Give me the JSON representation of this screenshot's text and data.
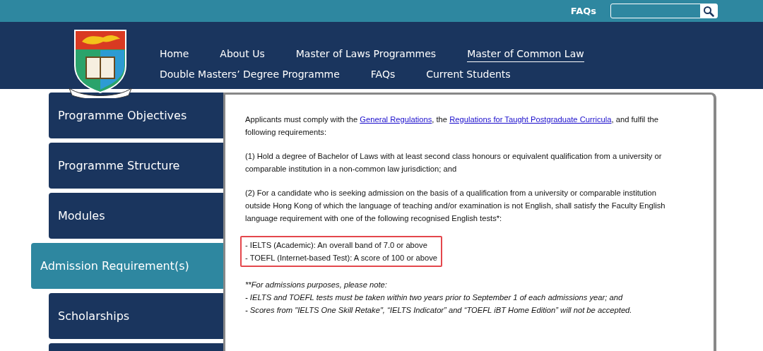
{
  "top_bar": {
    "link": "FAQs"
  },
  "nav": [
    {
      "label": "Home",
      "selected": false
    },
    {
      "label": "About Us",
      "selected": false
    },
    {
      "label": "Master of Laws Programmes",
      "selected": false
    },
    {
      "label": "Master of Common Law",
      "selected": true
    },
    {
      "label": "Double Masters’ Degree Programme",
      "selected": false
    },
    {
      "label": "FAQs",
      "selected": false
    },
    {
      "label": "Current Students",
      "selected": false
    }
  ],
  "sidebar": {
    "items": [
      {
        "label": "Programme Objectives",
        "selected": false
      },
      {
        "label": "Programme Structure",
        "selected": false
      },
      {
        "label": "Modules",
        "selected": false
      },
      {
        "label": "Admission Requirement(s)",
        "selected": true
      },
      {
        "label": "Scholarships",
        "selected": false
      }
    ]
  },
  "content": {
    "blocks": [
      {
        "kind": "paragraph",
        "parts": [
          {
            "link": false,
            "text": "Applicants must comply with the "
          },
          {
            "link": true,
            "text": "General Regulations"
          },
          {
            "link": false,
            "text": ", the "
          },
          {
            "link": true,
            "text": "Regulations for Taught Postgraduate Curricula"
          },
          {
            "link": false,
            "text": ", and fulfil the following requirements:"
          }
        ]
      },
      {
        "kind": "paragraph",
        "text": "(1) Hold a degree of Bachelor of Laws with at least second class honours or equivalent qualification from a university or comparable institution in a non-common law jurisdiction; and"
      },
      {
        "kind": "paragraph",
        "text": "(2) For a candidate who is seeking admission on the basis of a qualification from a university or comparable institution outside Hong Kong of which the language of teaching and/or examination is not English, shall satisfy the Faculty English language requirement with one of the following recognised English tests*:"
      },
      {
        "kind": "list",
        "highlighted": true,
        "lines": [
          "- IELTS (Academic): An overall band of 7.0 or above",
          "- TOEFL (Internet-based Test): A score of 100 or above"
        ]
      },
      {
        "kind": "note",
        "lines": [
          "**For admissions purposes, please note:",
          "- IELTS and TOEFL tests must be taken within two years prior to September 1 of each admissions year; and",
          "- Scores from \"IELTS One Skill Retake\", “IELTS Indicator” and “TOEFL iBT Home Edition” will not be accepted."
        ]
      }
    ]
  }
}
